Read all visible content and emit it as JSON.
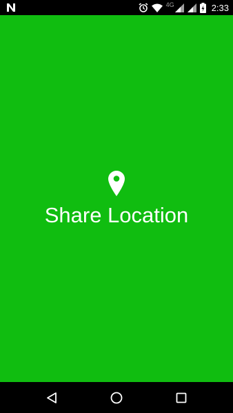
{
  "status_bar": {
    "network_type": "4G",
    "time": "2:33",
    "icons": [
      "n-logo-icon",
      "alarm-icon",
      "wifi-icon",
      "signal-icon",
      "signal-icon",
      "battery-charging-icon"
    ]
  },
  "screen": {
    "background_color": "#10bd10",
    "icon": "location-pin-icon",
    "title": "Share Location"
  },
  "nav_bar": {
    "buttons": [
      "back-icon",
      "home-icon",
      "recents-icon"
    ]
  }
}
